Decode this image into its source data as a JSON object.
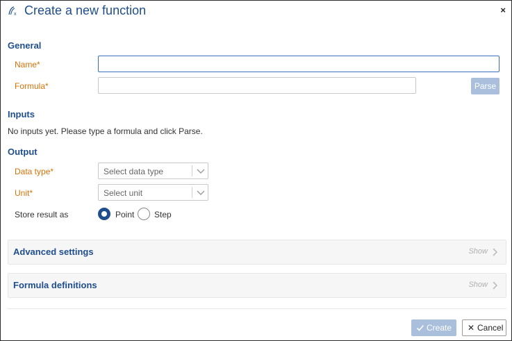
{
  "dialog": {
    "title": "Create a new function",
    "close_symbol": "×",
    "icon": "fx-icon"
  },
  "general": {
    "section_title": "General",
    "name_label": "Name",
    "formula_label": "Formula",
    "required_marker": "*",
    "name_value": "",
    "formula_value": "",
    "parse_label": "Parse"
  },
  "inputs": {
    "section_title": "Inputs",
    "message": "No inputs yet. Please type a formula and click Parse."
  },
  "output": {
    "section_title": "Output",
    "data_type_label": "Data type",
    "data_type_placeholder": "Select data type",
    "unit_label": "Unit",
    "unit_placeholder": "Select unit",
    "store_label": "Store result as",
    "options": [
      {
        "label": "Point",
        "selected": true
      },
      {
        "label": "Step",
        "selected": false
      }
    ]
  },
  "panels": [
    {
      "title": "Advanced settings",
      "toggle": "Show"
    },
    {
      "title": "Formula definitions",
      "toggle": "Show"
    }
  ],
  "footer": {
    "create_label": "Create",
    "cancel_label": "Cancel",
    "cancel_symbol": "✕"
  },
  "colors": {
    "accent": "#1f4e8c",
    "required": "#d4720a",
    "disabled_button": "#a9bfdc"
  }
}
